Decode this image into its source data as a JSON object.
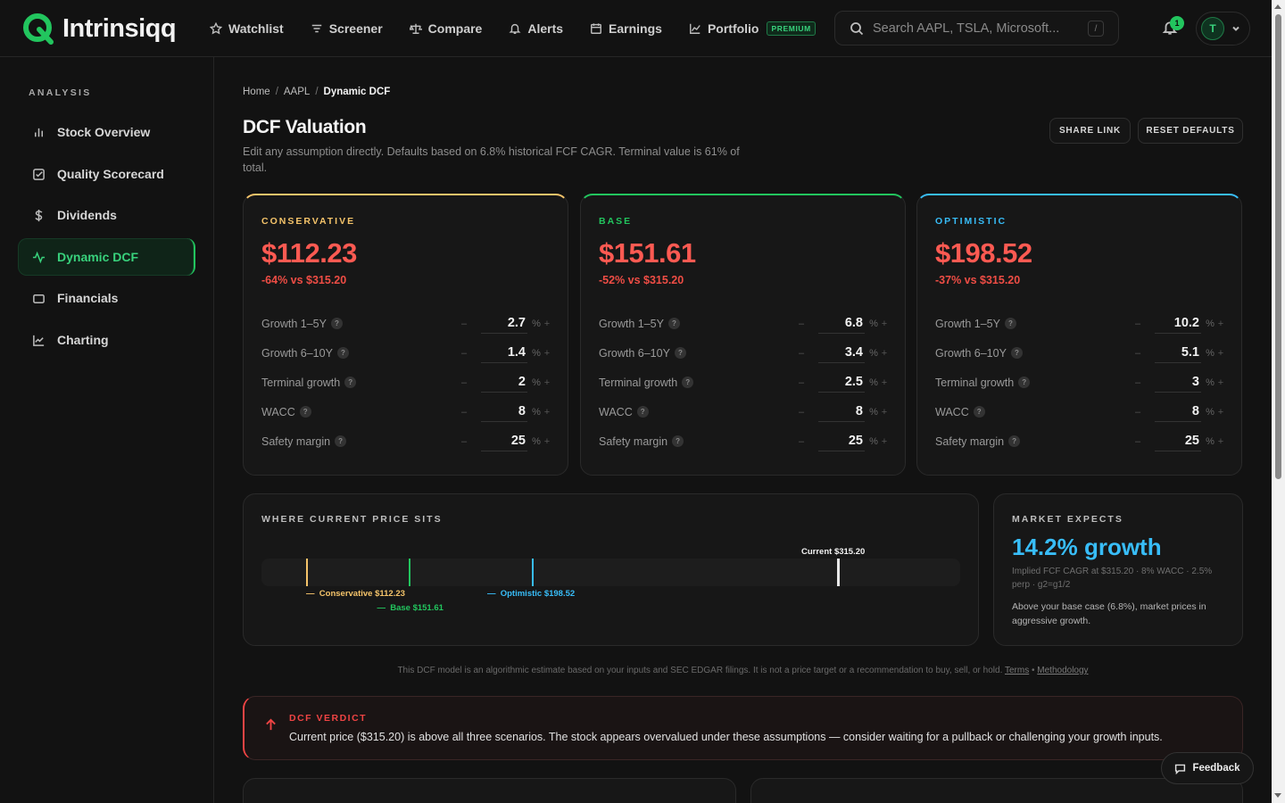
{
  "brand": {
    "name": "Intrinsiqq"
  },
  "nav": [
    {
      "label": "Watchlist",
      "icon": "star-icon"
    },
    {
      "label": "Screener",
      "icon": "filter-icon"
    },
    {
      "label": "Compare",
      "icon": "scale-icon"
    },
    {
      "label": "Alerts",
      "icon": "bell-icon"
    },
    {
      "label": "Earnings",
      "icon": "calendar-icon"
    },
    {
      "label": "Portfolio",
      "icon": "chart-line-icon",
      "badge": "PREMIUM"
    }
  ],
  "search": {
    "placeholder": "Search AAPL, TSLA, Microsoft...",
    "shortcut": "/"
  },
  "notifications": {
    "count": "1"
  },
  "user": {
    "initial": "T"
  },
  "sidebar": {
    "heading": "ANALYSIS",
    "items": [
      {
        "label": "Stock Overview",
        "icon": "bar-chart-icon"
      },
      {
        "label": "Quality Scorecard",
        "icon": "checkbox-icon"
      },
      {
        "label": "Dividends",
        "icon": "dollar-icon"
      },
      {
        "label": "Dynamic DCF",
        "icon": "pulse-icon",
        "active": true
      },
      {
        "label": "Financials",
        "icon": "wallet-icon"
      },
      {
        "label": "Charting",
        "icon": "line-chart-icon"
      }
    ]
  },
  "breadcrumb": {
    "home": "Home",
    "ticker": "AAPL",
    "current": "Dynamic DCF",
    "sep": "/"
  },
  "page": {
    "title": "DCF Valuation",
    "subtitle": "Edit any assumption directly. Defaults based on 6.8% historical FCF CAGR. Terminal value is 61% of total.",
    "share_label": "SHARE LINK",
    "reset_label": "RESET DEFAULTS"
  },
  "colors": {
    "conservative": "#f5c46a",
    "base": "#22c55e",
    "optimistic": "#38bdf8",
    "negative": "#ff5a52"
  },
  "scenarios": [
    {
      "label": "CONSERVATIVE",
      "value": "$112.23",
      "delta": "-64% vs $315.20",
      "rows": [
        {
          "label": "Growth 1–5Y",
          "value": "2.7"
        },
        {
          "label": "Growth 6–10Y",
          "value": "1.4"
        },
        {
          "label": "Terminal growth",
          "value": "2"
        },
        {
          "label": "WACC",
          "value": "8"
        },
        {
          "label": "Safety margin",
          "value": "25"
        }
      ]
    },
    {
      "label": "BASE",
      "value": "$151.61",
      "delta": "-52% vs $315.20",
      "rows": [
        {
          "label": "Growth 1–5Y",
          "value": "6.8"
        },
        {
          "label": "Growth 6–10Y",
          "value": "3.4"
        },
        {
          "label": "Terminal growth",
          "value": "2.5"
        },
        {
          "label": "WACC",
          "value": "8"
        },
        {
          "label": "Safety margin",
          "value": "25"
        }
      ]
    },
    {
      "label": "OPTIMISTIC",
      "value": "$198.52",
      "delta": "-37% vs $315.20",
      "rows": [
        {
          "label": "Growth 1–5Y",
          "value": "10.2"
        },
        {
          "label": "Growth 6–10Y",
          "value": "5.1"
        },
        {
          "label": "Terminal growth",
          "value": "3"
        },
        {
          "label": "WACC",
          "value": "8"
        },
        {
          "label": "Safety margin",
          "value": "25"
        }
      ]
    }
  ],
  "unit": {
    "pct": "%",
    "minus": "–",
    "plus": "+",
    "help": "?"
  },
  "price_position": {
    "heading": "WHERE CURRENT PRICE SITS",
    "current_label": "Current $315.20",
    "conservative_label": "Conservative $112.23",
    "base_label": "Base $151.61",
    "optimistic_label": "Optimistic $198.52",
    "marker_dash": "—",
    "marker_values": {
      "conservative": 112.23,
      "base": 151.61,
      "optimistic": 198.52,
      "current": 315.2
    }
  },
  "market_expects": {
    "heading": "MARKET EXPECTS",
    "value": "14.2% growth",
    "sub": "Implied FCF CAGR at $315.20 · 8% WACC · 2.5% perp · g2=g1/2",
    "desc": "Above your base case (6.8%), market prices in aggressive growth."
  },
  "disclaimer": {
    "text": "This DCF model is an algorithmic estimate based on your inputs and SEC EDGAR filings. It is not a price target or a recommendation to buy, sell, or hold.",
    "terms": "Terms",
    "bullet": "•",
    "methodology": "Methodology"
  },
  "verdict": {
    "label": "DCF VERDICT",
    "text": "Current price ($315.20) is above all three scenarios. The stock appears overvalued under these assumptions — consider waiting for a pullback or challenging your growth inputs."
  },
  "feedback": {
    "label": "Feedback"
  }
}
